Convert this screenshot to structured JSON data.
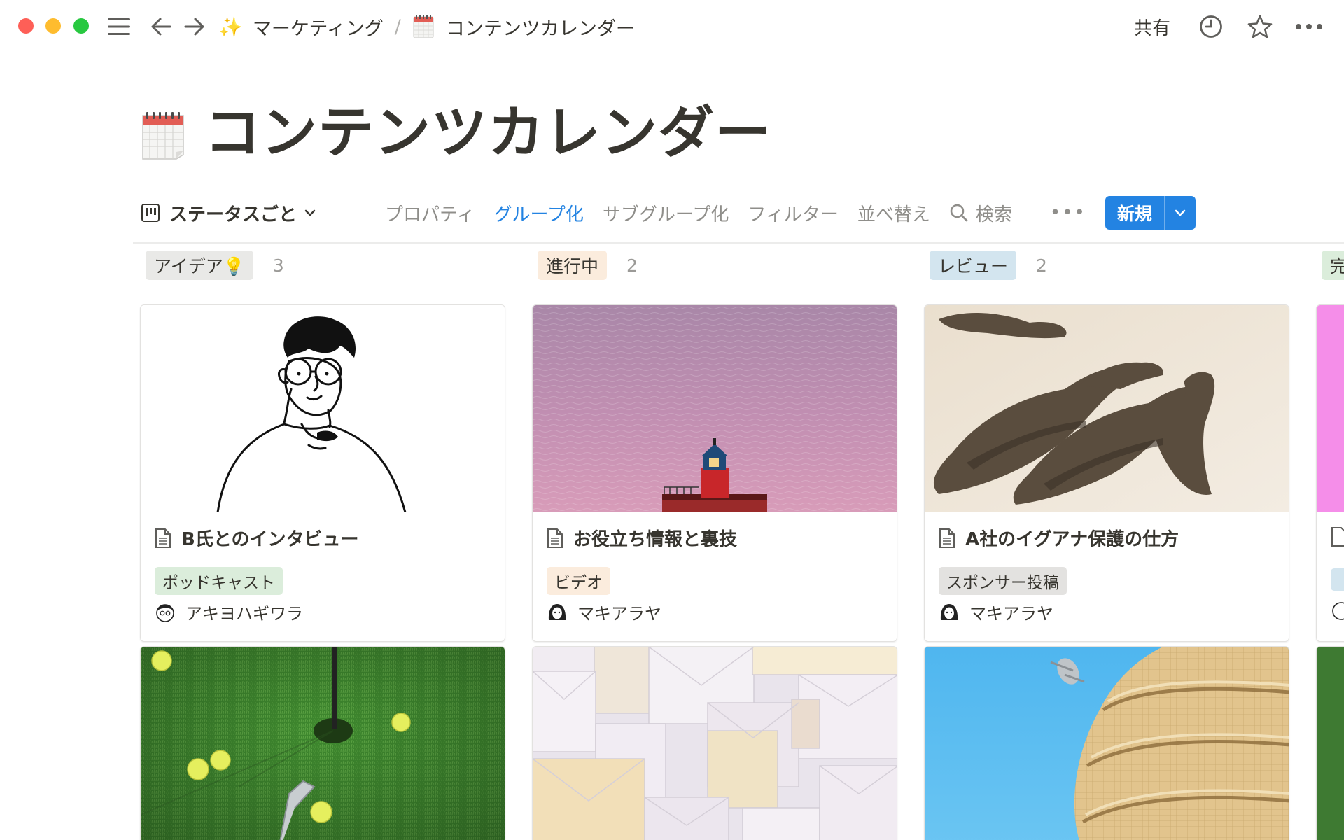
{
  "titlebar": {
    "breadcrumb": [
      {
        "emoji": "✨",
        "label": "マーケティング"
      },
      {
        "emoji": "🗓️",
        "label": "コンテンツカレンダー"
      }
    ],
    "separator": "/",
    "share_label": "共有"
  },
  "page": {
    "icon": "calendar-icon",
    "title": "コンテンツカレンダー"
  },
  "toolbar": {
    "view_label": "ステータスごと",
    "items": [
      "プロパティ",
      "グループ化",
      "サブグループ化",
      "フィルター",
      "並べ替え"
    ],
    "active_item": "グループ化",
    "search_label": "検索",
    "more": "•••",
    "new_label": "新規",
    "accent": "#2383e2"
  },
  "board": {
    "columns": [
      {
        "label": "アイデア💡",
        "count": "3",
        "bg": "#e9e9e7",
        "cards": [
          {
            "title": "B氏とのインタビュー",
            "tag": "ポッドキャスト",
            "tag_bg": "#dbeddb",
            "person": "アキヨハギワラ",
            "image": "illustration-man-glasses"
          },
          {
            "image": "golf-green"
          }
        ]
      },
      {
        "label": "進行中",
        "count": "2",
        "bg": "#fbecdd",
        "cards": [
          {
            "title": "お役立ち情報と裏技",
            "tag": "ビデオ",
            "tag_bg": "#fbecdd",
            "person": "マキアラヤ",
            "image": "lighthouse-sea"
          },
          {
            "image": "envelopes"
          }
        ]
      },
      {
        "label": "レビュー",
        "count": "2",
        "bg": "#d3e5ef",
        "cards": [
          {
            "title": "A社のイグアナ保護の仕方",
            "tag": "スポンサー投稿",
            "tag_bg": "#e3e2e0",
            "person": "マキアラヤ",
            "image": "iguanas-beach"
          },
          {
            "image": "building-sky"
          }
        ]
      },
      {
        "label": "完",
        "bg": "#dbeddb"
      }
    ]
  }
}
